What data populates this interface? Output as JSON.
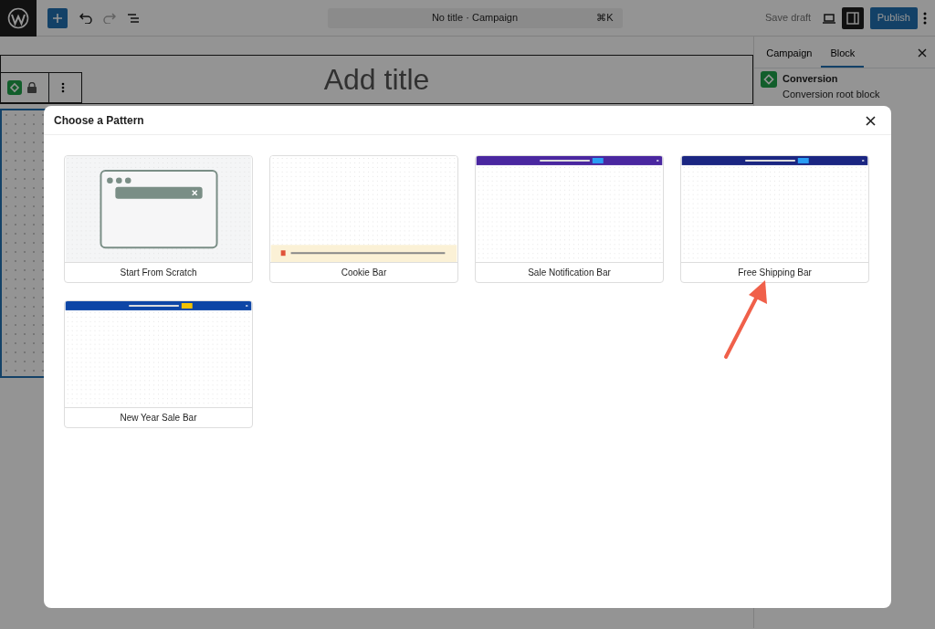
{
  "toolbar": {
    "title": "No title · Campaign",
    "shortcut": "⌘K",
    "save_draft": "Save draft",
    "publish": "Publish"
  },
  "editor": {
    "title_placeholder": "Add title"
  },
  "sidebar": {
    "tabs": [
      {
        "label": "Campaign",
        "selected": false
      },
      {
        "label": "Block",
        "selected": true
      }
    ],
    "block_name": "Conversion",
    "block_description": "Conversion root block"
  },
  "modal": {
    "title": "Choose a Pattern",
    "patterns": [
      {
        "label": "Start From Scratch",
        "kind": "scratch"
      },
      {
        "label": "Cookie Bar",
        "kind": "bottom-bar",
        "color": "#fbf1d6"
      },
      {
        "label": "Sale Notification Bar",
        "kind": "top-bar",
        "color": "#4a27a0"
      },
      {
        "label": "Free Shipping Bar",
        "kind": "top-bar",
        "color": "#1b2682"
      },
      {
        "label": "New Year Sale Bar",
        "kind": "top-bar",
        "color": "#0e46a6"
      }
    ]
  }
}
